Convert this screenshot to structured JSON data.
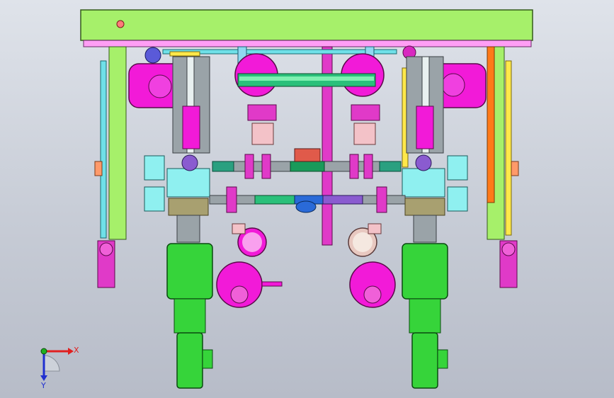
{
  "viewport": {
    "background_top": "#dfe3ea",
    "background_bottom": "#b7bcc8"
  },
  "triad": {
    "x_label": "X",
    "y_label": "Y",
    "x_color": "#e02020",
    "y_color": "#2030d0",
    "z_color": "#20b020"
  },
  "palette": {
    "frame_green": "#a6f06a",
    "frame_pink": "#ff9ef5",
    "motor_green": "#36d43a",
    "pump_magenta": "#f21ad8",
    "pipe_gray": "#9aa3a8",
    "pipe_cyan": "#6fe0e8",
    "valve_cyan": "#8ff0f0",
    "flange_purple": "#8a5bd0",
    "orange_plate": "#ff7a18",
    "yellow_bar": "#ffe84a",
    "dark_green": "#1a9a5a"
  }
}
